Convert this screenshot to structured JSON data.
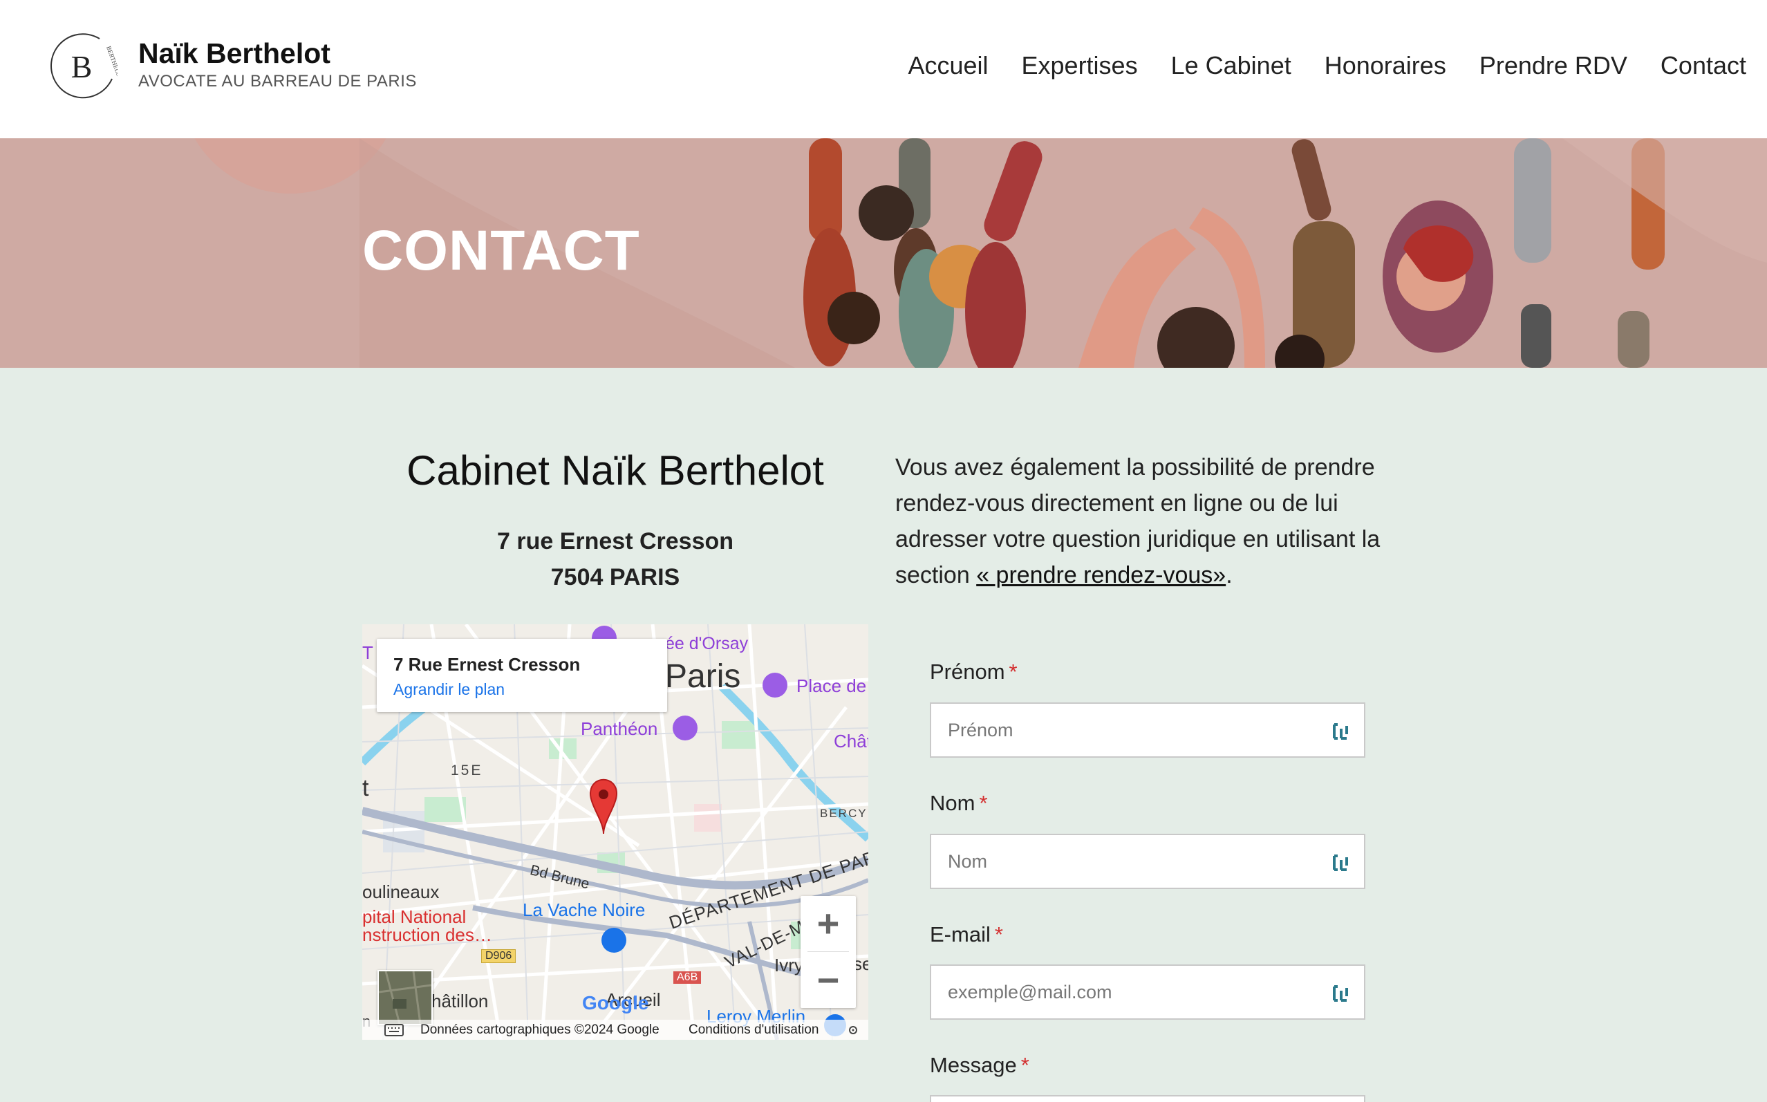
{
  "header": {
    "logo_letter": "B",
    "logo_ring_text": "BERTHELOT",
    "brand_name": "Naïk Berthelot",
    "brand_subtitle": "AVOCATE AU BARREAU DE PARIS",
    "nav": [
      "Accueil",
      "Expertises",
      "Le Cabinet",
      "Honoraires",
      "Prendre RDV",
      "Contact"
    ]
  },
  "hero": {
    "title": "CONTACT"
  },
  "cabinet": {
    "title": "Cabinet Naïk Berthelot",
    "address_line1": "7 rue Ernest Cresson",
    "address_line2": "7504 PARIS"
  },
  "map": {
    "card_title": "7 Rue Ernest Cresson",
    "card_link": "Agrandir le plan",
    "labels": {
      "paris": "Paris",
      "orsay": "ée d'Orsay",
      "place": "Place de",
      "pantheon": "Panthéon",
      "chat": "Chât",
      "quinze": "15E",
      "bercy": "BERCY",
      "bd_brune": "Bd Brune",
      "departement": "DÉPARTEMENT DE PARI",
      "valdem": "VAL-DE-M",
      "moulineaux": "oulineaux",
      "hopital1": "pital National",
      "hopital2": "nstruction des…",
      "vache_noire": "La Vache Noire",
      "d906": "D906",
      "a6b": "A6B",
      "ivry": "Ivry",
      "se": "se",
      "chatillon": "hâtillon",
      "arcueil": "Arcueil",
      "leroy": "Leroy Merlin",
      "google": "Google",
      "t_left": "T",
      "t_left2": "t",
      "m_left": "n"
    },
    "footer_data": "Données cartographiques ©2024 Google",
    "footer_terms": "Conditions d'utilisation",
    "zoom_in": "+",
    "zoom_out": "−"
  },
  "intro": {
    "text": "Vous avez également la possibilité de prendre rendez-vous directement en ligne ou de lui adresser votre question juridique en utilisant la section ",
    "link": "« prendre rendez-vous»",
    "end": "."
  },
  "form": {
    "required_mark": "*",
    "fields": [
      {
        "label": "Prénom",
        "placeholder": "Prénom"
      },
      {
        "label": "Nom",
        "placeholder": "Nom"
      },
      {
        "label": "E-mail",
        "placeholder": "exemple@mail.com"
      }
    ],
    "message_label": "Message"
  },
  "colors": {
    "hero_bg": "#cfaaa3",
    "page_bg": "#e4ede7",
    "required": "#d32f2f",
    "map_link": "#1a73e8",
    "map_pin": "#e53935"
  }
}
